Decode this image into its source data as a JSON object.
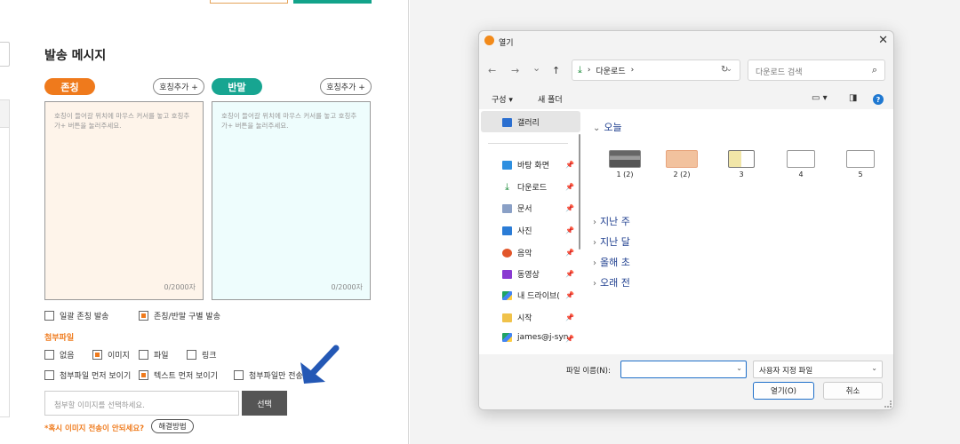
{
  "page": {
    "section_title": "발송 메시지",
    "honor_label": "존칭",
    "casual_label": "반말",
    "add_title_btn": "호칭추가 +",
    "placeholder": "호칭이 들어갈 위치에 마우스 커서를 놓고 호칭추가+ 버튼을 눌러주세요.",
    "counter": "0/2000자",
    "opt_bulk_honor": "일괄 존칭 발송",
    "opt_split": "존칭/반말 구별 발송",
    "attach_title": "첨부파일",
    "attach_none": "없음",
    "attach_image": "이미지",
    "attach_file": "파일",
    "attach_link": "링크",
    "show_attach_first": "첨부파일 먼저 보이기",
    "show_text_first": "텍스트 먼저 보이기",
    "attach_only": "첨부파일만 전송",
    "file_placeholder": "첨부할 이미지를 선택하세요.",
    "select_btn": "선택",
    "warn_text": "*혹시 이미지 전송이 안되세요?",
    "solve_btn": "해결방법",
    "accent_orange": "#ef7a1c",
    "accent_teal": "#17a591"
  },
  "dialog": {
    "title": "열기",
    "close": "✕",
    "back": "←",
    "forward": "→",
    "down": "⌄",
    "up": "↑",
    "address": "다운로드",
    "address_sep": "›",
    "refresh": "↻",
    "search_placeholder": "다운로드 검색",
    "organize": "구성 ▾",
    "new_folder": "새 폴더",
    "nav": {
      "gallery": "갤러리",
      "desktop": "바탕 화면",
      "downloads": "다운로드",
      "documents": "문서",
      "pictures": "사진",
      "music": "음악",
      "videos": "동영상",
      "drive": "내 드라이브(",
      "start": "시작",
      "account": "james@j-syn"
    },
    "groups": {
      "today": "오늘",
      "last_week": "지난 주",
      "last_month": "지난 달",
      "early_year": "올해 초",
      "long_ago": "오래 전"
    },
    "files": [
      "1 (2)",
      "2 (2)",
      "3",
      "4",
      "5"
    ],
    "filename_label": "파일 이름(N):",
    "filetype": "사용자 지정 파일",
    "open_btn": "열기(O)",
    "cancel_btn": "취소"
  }
}
